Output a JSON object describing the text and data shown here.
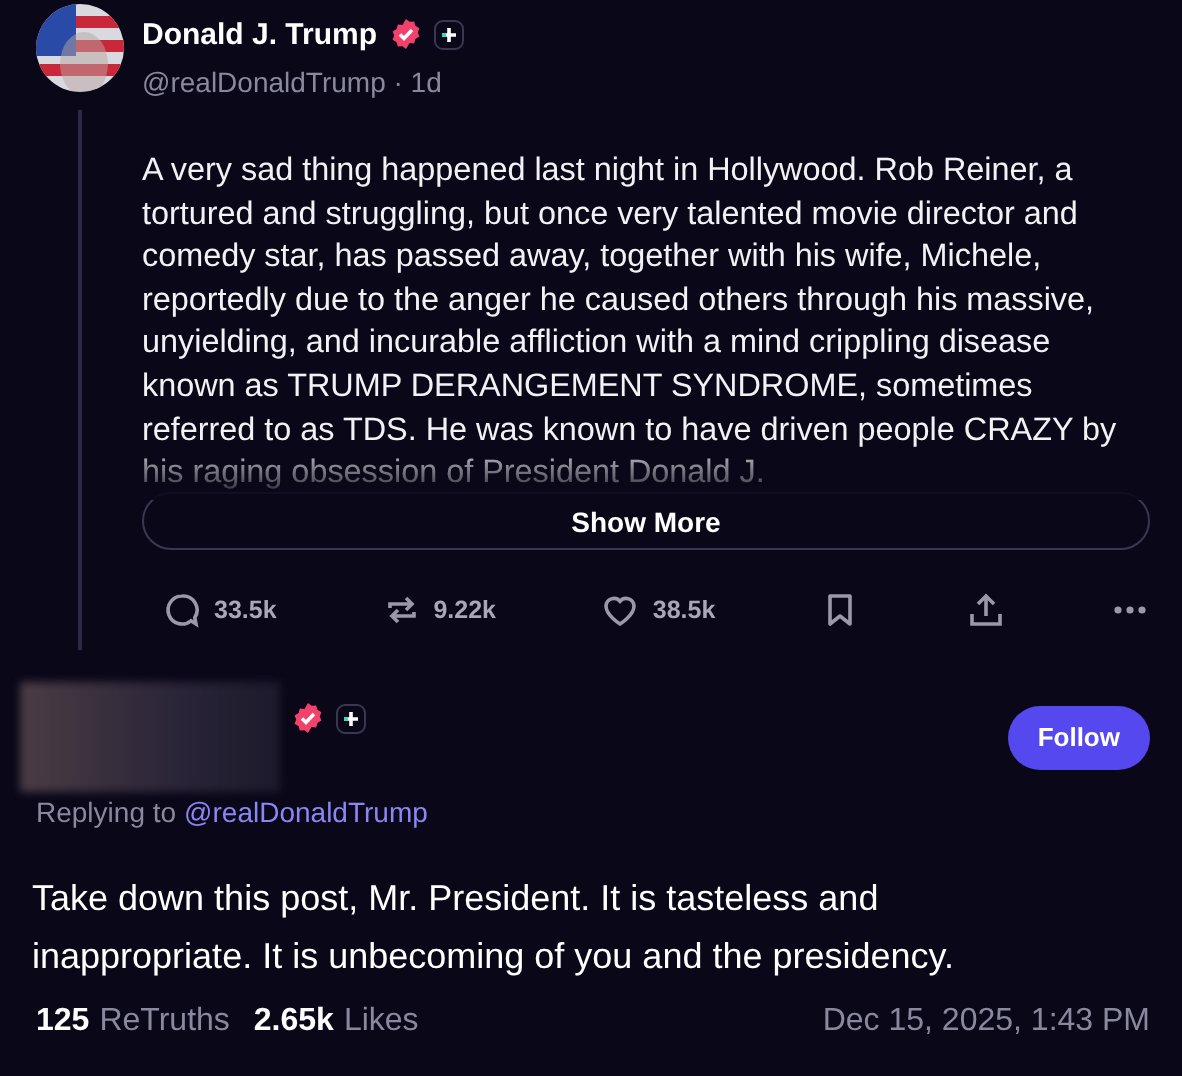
{
  "post": {
    "author": {
      "name": "Donald J. Trump",
      "verified": true,
      "handle": "@realDonaldTrump",
      "separator": "·",
      "age": "1d"
    },
    "text": [
      "A very sad thing happened last night in Hollywood. Rob Reiner, a tortured and struggling, but once very talented movie director and comedy star, has passed away, together with his wife, Michele, reportedly due to the anger he caused others through his massive, unyielding, and incurable affliction with a mind crippling disease known as TRUMP DERANGEMENT SYNDROME, sometimes referred to as TDS. He was known to have driven people CRAZY by his raging obsession of President Donald J."
    ],
    "show_more": "Show More",
    "actions": [
      {
        "kind": "reply",
        "count": "33.5k"
      },
      {
        "kind": "retruth",
        "count": "9.22k"
      },
      {
        "kind": "like",
        "count": "38.5k"
      },
      {
        "kind": "bookmark"
      },
      {
        "kind": "share"
      },
      {
        "kind": "more"
      }
    ]
  },
  "reply": {
    "verified": true,
    "follow": "Follow",
    "replying_prefix": "Replying to",
    "replying_handle": "@realDonaldTrump",
    "text": "Take down this post, Mr. President. It is tasteless and inappropriate.  It is unbecoming of you and the presidency.",
    "stats": [
      {
        "count": "125",
        "label": "ReTruths"
      },
      {
        "count": "2.65k",
        "label": "Likes"
      }
    ],
    "timestamp": "Dec 15, 2025, 1:43 PM"
  }
}
